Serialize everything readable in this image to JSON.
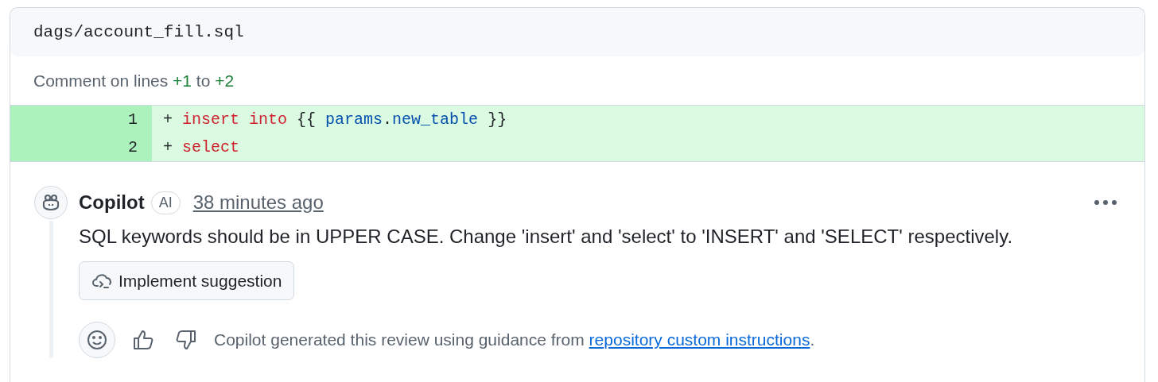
{
  "file": {
    "path": "dags/account_fill.sql"
  },
  "comment_range": [
    {
      "text": "Comment on lines ",
      "kind": "plain"
    },
    {
      "text": "+1",
      "kind": "added"
    },
    {
      "text": " to ",
      "kind": "plain"
    },
    {
      "text": "+2",
      "kind": "added"
    }
  ],
  "diff_lines": [
    {
      "number": "1",
      "tokens": [
        {
          "text": "+ ",
          "kind": "plain"
        },
        {
          "text": "insert",
          "kind": "keyword"
        },
        {
          "text": " into",
          "kind": "keyword"
        },
        {
          "text": " {{ ",
          "kind": "plain"
        },
        {
          "text": "params",
          "kind": "entity"
        },
        {
          "text": ".",
          "kind": "plain"
        },
        {
          "text": "new_table",
          "kind": "entity"
        },
        {
          "text": " }}",
          "kind": "plain"
        }
      ]
    },
    {
      "number": "2",
      "tokens": [
        {
          "text": "+ ",
          "kind": "plain"
        },
        {
          "text": "select",
          "kind": "keyword"
        }
      ]
    }
  ],
  "review_comment": {
    "author": "Copilot",
    "badge": "AI",
    "time": "38 minutes ago",
    "body": "SQL keywords should be in UPPER CASE. Change 'insert' and 'select' to 'INSERT' and 'SELECT' respectively.",
    "action": "Implement suggestion",
    "footer": {
      "before": "Copilot generated this review using guidance from ",
      "link": "repository custom instructions",
      "after": "."
    }
  }
}
